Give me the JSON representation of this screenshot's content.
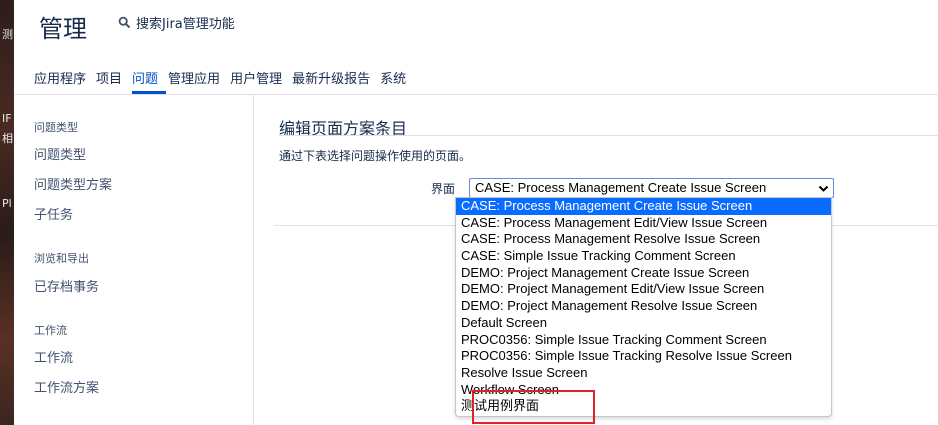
{
  "desktop_fragments": [
    "测",
    "IF",
    "相",
    "Pl"
  ],
  "app": {
    "title": "管理",
    "search": {
      "label": "搜索Jira管理功能",
      "icon": "search-icon"
    }
  },
  "tabs": [
    {
      "label": "应用程序",
      "active": false
    },
    {
      "label": "项目",
      "active": false
    },
    {
      "label": "问题",
      "active": true
    },
    {
      "label": "管理应用",
      "active": false
    },
    {
      "label": "用户管理",
      "active": false
    },
    {
      "label": "最新升级报告",
      "active": false
    },
    {
      "label": "系统",
      "active": false
    }
  ],
  "sidebar": {
    "sections": [
      {
        "heading": "问题类型",
        "items": [
          "问题类型",
          "问题类型方案",
          "子任务"
        ]
      },
      {
        "heading": "浏览和导出",
        "items": [
          "已存档事务"
        ]
      },
      {
        "heading": "工作流",
        "items": [
          "工作流",
          "工作流方案"
        ]
      }
    ]
  },
  "main": {
    "heading": "编辑页面方案条目",
    "description": "通过下表选择问题操作使用的页面。",
    "field_label": "界面",
    "select": {
      "value": "CASE: Process Management Create Issue Screen",
      "options": [
        "CASE: Process Management Create Issue Screen",
        "CASE: Process Management Edit/View Issue Screen",
        "CASE: Process Management Resolve Issue Screen",
        "CASE: Simple Issue Tracking Comment Screen",
        "DEMO: Project Management Create Issue Screen",
        "DEMO: Project Management Edit/View Issue Screen",
        "DEMO: Project Management Resolve Issue Screen",
        "Default Screen",
        "PROC0356: Simple Issue Tracking Comment Screen",
        "PROC0356: Simple Issue Tracking Resolve Issue Screen",
        "Resolve Issue Screen",
        "Workflow Screen",
        "测试用例界面"
      ],
      "selected_index": 0
    }
  },
  "colors": {
    "accent": "#0052cc",
    "selected_option_bg": "#0a6cff",
    "annotation_box": "#e0202a"
  }
}
